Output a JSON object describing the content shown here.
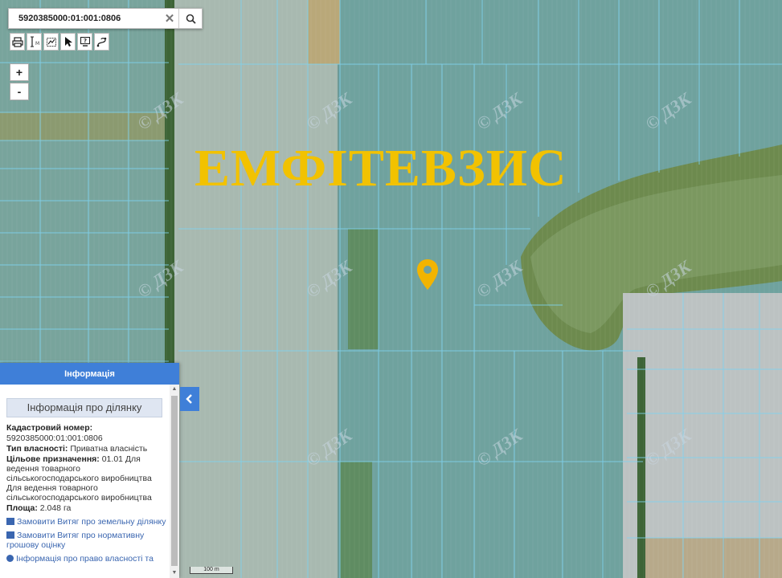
{
  "colors": {
    "accent": "#3f7fd8",
    "banner": "#f2c200",
    "marker": "#f2b400",
    "parcel_lines": "#7fd3f0"
  },
  "search": {
    "value": "5920385000:01:001:0806",
    "clear_icon": "close-icon",
    "search_icon": "search-icon"
  },
  "toolbar": {
    "tools": [
      "print-icon",
      "measure-icon",
      "select-area-icon",
      "pointer-icon",
      "info-icon",
      "route-icon"
    ]
  },
  "zoom": {
    "in_label": "+",
    "out_label": "-"
  },
  "map": {
    "banner_text": "ЕМФІТЕВЗИС",
    "watermark_text": "© ДЗК",
    "marker_icon": "location-pin-icon",
    "scale_label": "100 m"
  },
  "panel": {
    "header": "Інформація",
    "section_title": "Інформація про ділянку",
    "cadastral_label": "Кадастровий номер:",
    "cadastral_value": "5920385000:01:001:0806",
    "ownership_label": "Тип власності:",
    "ownership_value": "Приватна власність",
    "purpose_label": "Цільове призначення:",
    "purpose_value": "01.01 Для ведення товарного сільськогосподарського виробництва Для ведення товарного сільськогосподарського виробництва",
    "area_label": "Площа:",
    "area_value": "2.048 га",
    "link_extract": "Замовити Витяг про земельну ділянку",
    "link_valuation": "Замовити Витяг про нормативну грошову оцінку",
    "link_rights": "Інформація про право власності та"
  }
}
